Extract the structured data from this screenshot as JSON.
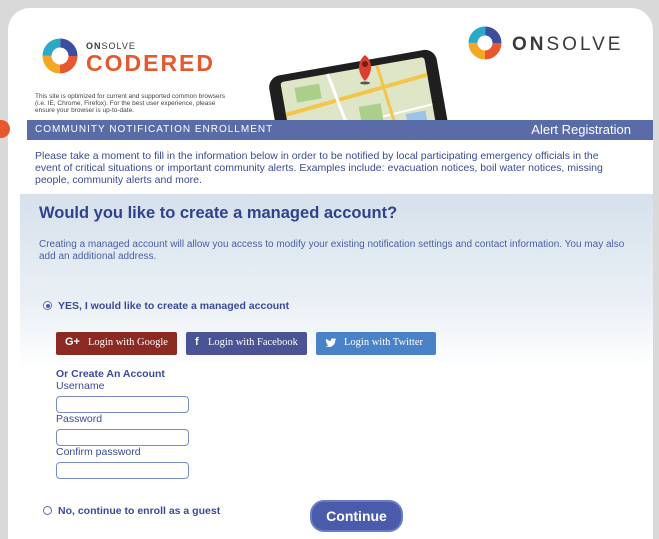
{
  "brand": {
    "codered_small_prefix": "ON",
    "codered_small_suffix": "SOLVE",
    "codered_name": "CODERED",
    "onsolve_prefix": "ON",
    "onsolve_suffix": "SOLVE",
    "optimized_note": "This site is optimized for current and supported common browsers (i.e. IE, Chrome, Firefox). For the best user experience, please ensure your browser is up-to-date."
  },
  "colors": {
    "accent_orange": "#e8582f",
    "bar_blue": "#5a6ca8",
    "title_blue": "#2f4290",
    "google_red": "#8a2a22",
    "facebook_blue": "#4a5394",
    "twitter_blue": "#4a82c8",
    "button_blue": "#4a5bab"
  },
  "bar": {
    "left": "COMMUNITY NOTIFICATION ENROLLMENT",
    "right": "Alert Registration"
  },
  "intro": "Please take a moment to fill in the information below in order to be notified by local participating emergency officials in the event of critical situations or important community alerts. Examples include: evacuation notices, boil water notices, missing people, community alerts and more.",
  "managed": {
    "title": "Would you like to create a managed account?",
    "description": "Creating a managed account will allow you access to modify your existing notification settings and contact information. You may also add an additional address.",
    "yes_label": "YES, I would like to create a managed account",
    "yes_selected": true
  },
  "social": {
    "google_icon": "G+",
    "google": "Login with Google",
    "facebook_icon": "f",
    "facebook": "Login with Facebook",
    "twitter": "Login with Twitter"
  },
  "create": {
    "heading": "Or Create An Account",
    "username_label": "Username",
    "username_value": "",
    "password_label": "Password",
    "password_value": "",
    "confirm_label": "Confirm password",
    "confirm_value": ""
  },
  "guest": {
    "label": "No, continue to enroll as a guest",
    "selected": false
  },
  "continue_label": "Continue"
}
